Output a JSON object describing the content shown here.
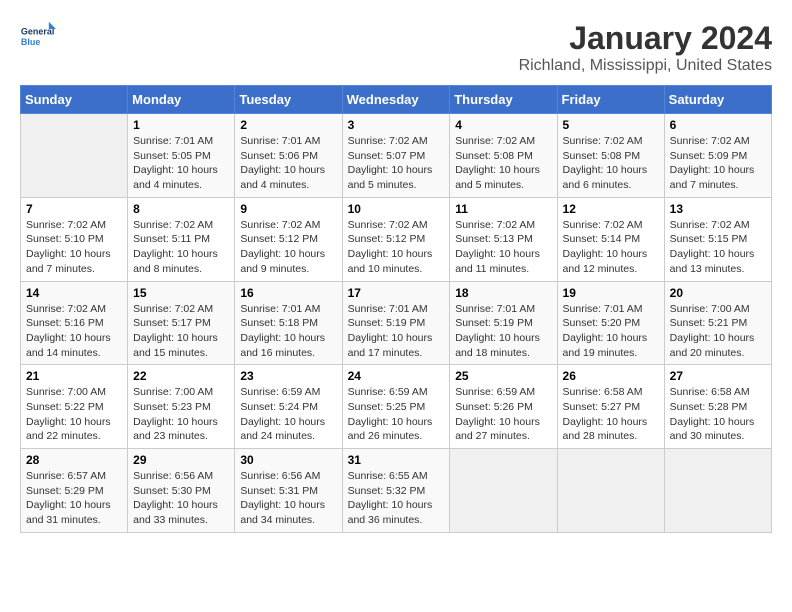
{
  "header": {
    "logo_line1": "General",
    "logo_line2": "Blue",
    "title": "January 2024",
    "subtitle": "Richland, Mississippi, United States"
  },
  "days_of_week": [
    "Sunday",
    "Monday",
    "Tuesday",
    "Wednesday",
    "Thursday",
    "Friday",
    "Saturday"
  ],
  "weeks": [
    [
      {
        "num": "",
        "info": ""
      },
      {
        "num": "1",
        "info": "Sunrise: 7:01 AM\nSunset: 5:05 PM\nDaylight: 10 hours\nand 4 minutes."
      },
      {
        "num": "2",
        "info": "Sunrise: 7:01 AM\nSunset: 5:06 PM\nDaylight: 10 hours\nand 4 minutes."
      },
      {
        "num": "3",
        "info": "Sunrise: 7:02 AM\nSunset: 5:07 PM\nDaylight: 10 hours\nand 5 minutes."
      },
      {
        "num": "4",
        "info": "Sunrise: 7:02 AM\nSunset: 5:08 PM\nDaylight: 10 hours\nand 5 minutes."
      },
      {
        "num": "5",
        "info": "Sunrise: 7:02 AM\nSunset: 5:08 PM\nDaylight: 10 hours\nand 6 minutes."
      },
      {
        "num": "6",
        "info": "Sunrise: 7:02 AM\nSunset: 5:09 PM\nDaylight: 10 hours\nand 7 minutes."
      }
    ],
    [
      {
        "num": "7",
        "info": "Sunrise: 7:02 AM\nSunset: 5:10 PM\nDaylight: 10 hours\nand 7 minutes."
      },
      {
        "num": "8",
        "info": "Sunrise: 7:02 AM\nSunset: 5:11 PM\nDaylight: 10 hours\nand 8 minutes."
      },
      {
        "num": "9",
        "info": "Sunrise: 7:02 AM\nSunset: 5:12 PM\nDaylight: 10 hours\nand 9 minutes."
      },
      {
        "num": "10",
        "info": "Sunrise: 7:02 AM\nSunset: 5:12 PM\nDaylight: 10 hours\nand 10 minutes."
      },
      {
        "num": "11",
        "info": "Sunrise: 7:02 AM\nSunset: 5:13 PM\nDaylight: 10 hours\nand 11 minutes."
      },
      {
        "num": "12",
        "info": "Sunrise: 7:02 AM\nSunset: 5:14 PM\nDaylight: 10 hours\nand 12 minutes."
      },
      {
        "num": "13",
        "info": "Sunrise: 7:02 AM\nSunset: 5:15 PM\nDaylight: 10 hours\nand 13 minutes."
      }
    ],
    [
      {
        "num": "14",
        "info": "Sunrise: 7:02 AM\nSunset: 5:16 PM\nDaylight: 10 hours\nand 14 minutes."
      },
      {
        "num": "15",
        "info": "Sunrise: 7:02 AM\nSunset: 5:17 PM\nDaylight: 10 hours\nand 15 minutes."
      },
      {
        "num": "16",
        "info": "Sunrise: 7:01 AM\nSunset: 5:18 PM\nDaylight: 10 hours\nand 16 minutes."
      },
      {
        "num": "17",
        "info": "Sunrise: 7:01 AM\nSunset: 5:19 PM\nDaylight: 10 hours\nand 17 minutes."
      },
      {
        "num": "18",
        "info": "Sunrise: 7:01 AM\nSunset: 5:19 PM\nDaylight: 10 hours\nand 18 minutes."
      },
      {
        "num": "19",
        "info": "Sunrise: 7:01 AM\nSunset: 5:20 PM\nDaylight: 10 hours\nand 19 minutes."
      },
      {
        "num": "20",
        "info": "Sunrise: 7:00 AM\nSunset: 5:21 PM\nDaylight: 10 hours\nand 20 minutes."
      }
    ],
    [
      {
        "num": "21",
        "info": "Sunrise: 7:00 AM\nSunset: 5:22 PM\nDaylight: 10 hours\nand 22 minutes."
      },
      {
        "num": "22",
        "info": "Sunrise: 7:00 AM\nSunset: 5:23 PM\nDaylight: 10 hours\nand 23 minutes."
      },
      {
        "num": "23",
        "info": "Sunrise: 6:59 AM\nSunset: 5:24 PM\nDaylight: 10 hours\nand 24 minutes."
      },
      {
        "num": "24",
        "info": "Sunrise: 6:59 AM\nSunset: 5:25 PM\nDaylight: 10 hours\nand 26 minutes."
      },
      {
        "num": "25",
        "info": "Sunrise: 6:59 AM\nSunset: 5:26 PM\nDaylight: 10 hours\nand 27 minutes."
      },
      {
        "num": "26",
        "info": "Sunrise: 6:58 AM\nSunset: 5:27 PM\nDaylight: 10 hours\nand 28 minutes."
      },
      {
        "num": "27",
        "info": "Sunrise: 6:58 AM\nSunset: 5:28 PM\nDaylight: 10 hours\nand 30 minutes."
      }
    ],
    [
      {
        "num": "28",
        "info": "Sunrise: 6:57 AM\nSunset: 5:29 PM\nDaylight: 10 hours\nand 31 minutes."
      },
      {
        "num": "29",
        "info": "Sunrise: 6:56 AM\nSunset: 5:30 PM\nDaylight: 10 hours\nand 33 minutes."
      },
      {
        "num": "30",
        "info": "Sunrise: 6:56 AM\nSunset: 5:31 PM\nDaylight: 10 hours\nand 34 minutes."
      },
      {
        "num": "31",
        "info": "Sunrise: 6:55 AM\nSunset: 5:32 PM\nDaylight: 10 hours\nand 36 minutes."
      },
      {
        "num": "",
        "info": ""
      },
      {
        "num": "",
        "info": ""
      },
      {
        "num": "",
        "info": ""
      }
    ]
  ]
}
